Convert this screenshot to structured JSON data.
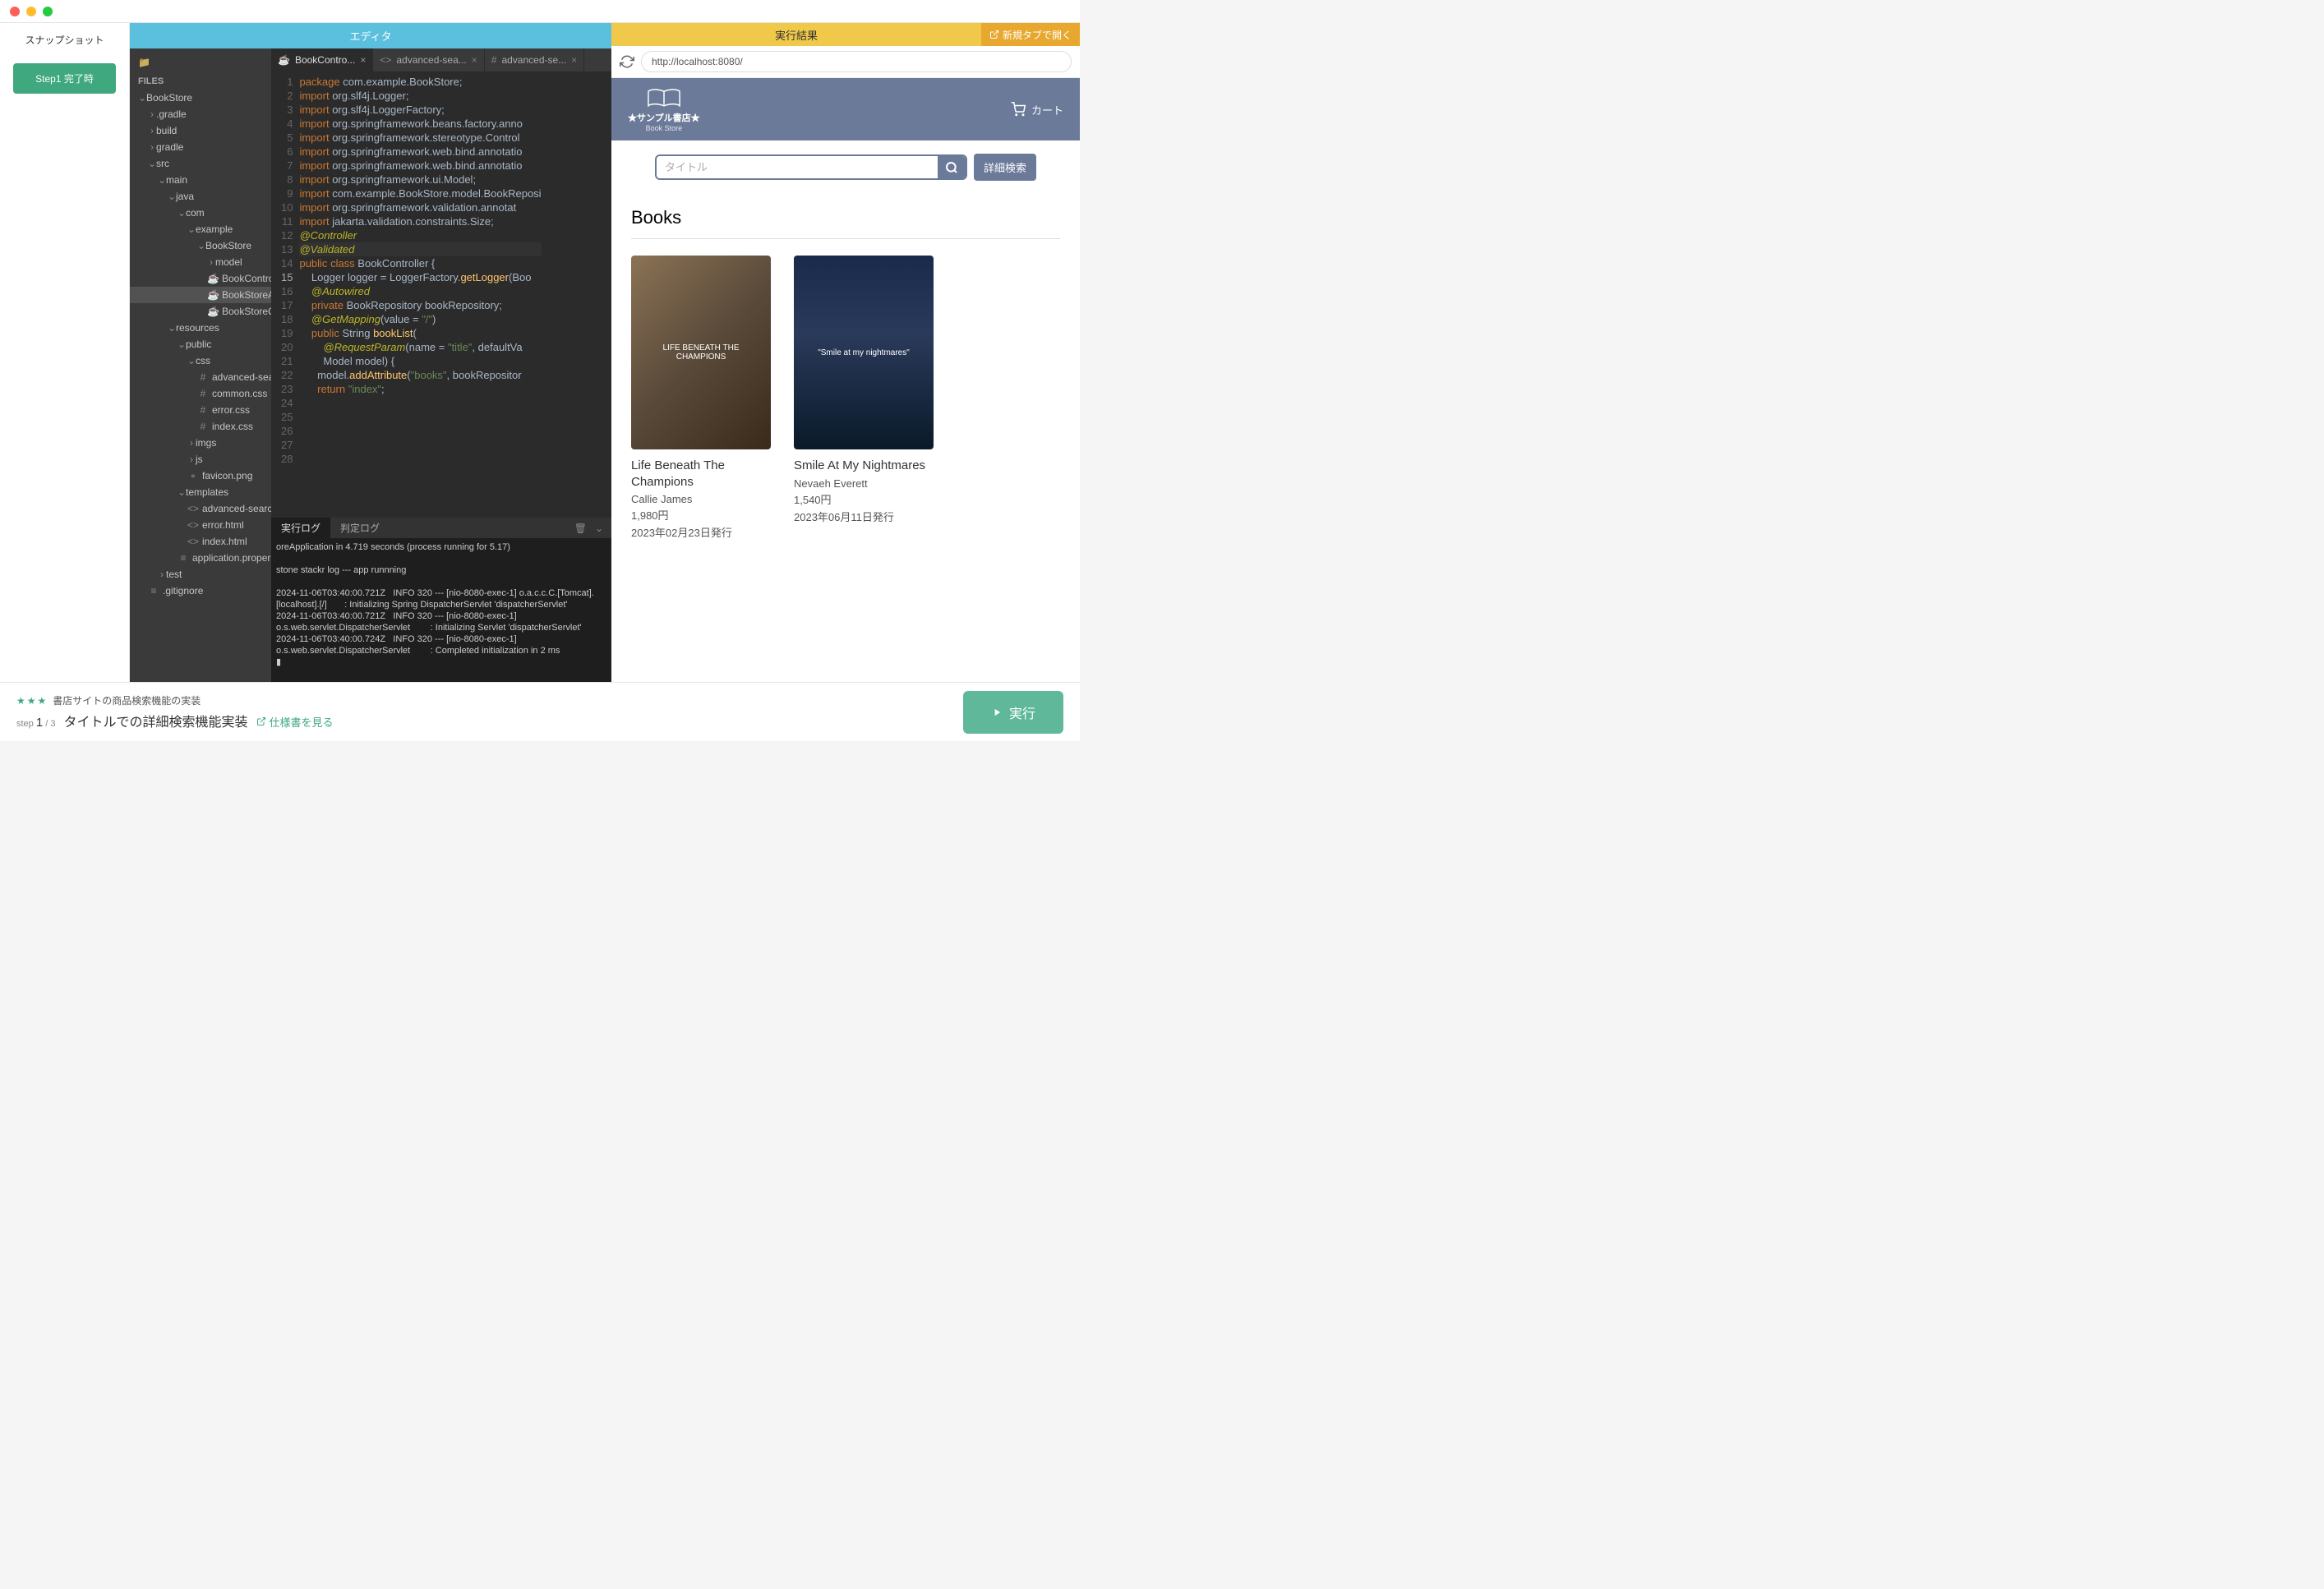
{
  "snapshot": {
    "title": "スナップショット",
    "step_btn": "Step1 完了時"
  },
  "editor": {
    "title": "エディタ"
  },
  "filetree": {
    "files_label": "FILES",
    "items": [
      {
        "label": "BookStore",
        "indent": 10,
        "expanded": true
      },
      {
        "label": ".gradle",
        "indent": 22,
        "expanded": false
      },
      {
        "label": "build",
        "indent": 22,
        "expanded": false
      },
      {
        "label": "gradle",
        "indent": 22,
        "expanded": false
      },
      {
        "label": "src",
        "indent": 22,
        "expanded": true
      },
      {
        "label": "main",
        "indent": 34,
        "expanded": true
      },
      {
        "label": "java",
        "indent": 46,
        "expanded": true
      },
      {
        "label": "com",
        "indent": 58,
        "expanded": true
      },
      {
        "label": "example",
        "indent": 70,
        "expanded": true
      },
      {
        "label": "BookStore",
        "indent": 82,
        "expanded": true
      },
      {
        "label": "model",
        "indent": 94,
        "expanded": false
      },
      {
        "label": "BookControll",
        "indent": 94,
        "file": "java"
      },
      {
        "label": "BookStoreAp",
        "indent": 94,
        "file": "java",
        "selected": true
      },
      {
        "label": "BookStoreCo",
        "indent": 94,
        "file": "java"
      },
      {
        "label": "resources",
        "indent": 46,
        "expanded": true
      },
      {
        "label": "public",
        "indent": 58,
        "expanded": true
      },
      {
        "label": "css",
        "indent": 70,
        "expanded": true
      },
      {
        "label": "advanced-sear",
        "indent": 82,
        "file": "css"
      },
      {
        "label": "common.css",
        "indent": 82,
        "file": "css"
      },
      {
        "label": "error.css",
        "indent": 82,
        "file": "css"
      },
      {
        "label": "index.css",
        "indent": 82,
        "file": "css"
      },
      {
        "label": "imgs",
        "indent": 70,
        "expanded": false
      },
      {
        "label": "js",
        "indent": 70,
        "expanded": false
      },
      {
        "label": "favicon.png",
        "indent": 70,
        "file": "img"
      },
      {
        "label": "templates",
        "indent": 58,
        "expanded": true
      },
      {
        "label": "advanced-searc",
        "indent": 70,
        "file": "html"
      },
      {
        "label": "error.html",
        "indent": 70,
        "file": "html"
      },
      {
        "label": "index.html",
        "indent": 70,
        "file": "html"
      },
      {
        "label": "application.proper",
        "indent": 58,
        "file": "cfg"
      },
      {
        "label": "test",
        "indent": 34,
        "expanded": false
      },
      {
        "label": ".gitignore",
        "indent": 22,
        "file": "cfg"
      }
    ]
  },
  "tabs": [
    {
      "label": "BookContro...",
      "icon": "java",
      "active": true
    },
    {
      "label": "advanced-sea...",
      "icon": "html",
      "active": false
    },
    {
      "label": "advanced-se...",
      "icon": "css",
      "active": false
    }
  ],
  "code": {
    "lines": [
      "<span class='kw'>package</span> com.example.BookStore;",
      "",
      "<span class='kw'>import</span> org.slf4j.Logger;",
      "<span class='kw'>import</span> org.slf4j.LoggerFactory;",
      "<span class='kw'>import</span> org.springframework.beans.factory.anno",
      "<span class='kw'>import</span> org.springframework.stereotype.Control",
      "<span class='kw'>import</span> org.springframework.web.bind.annotatio",
      "<span class='kw'>import</span> org.springframework.web.bind.annotatio",
      "<span class='kw'>import</span> org.springframework.ui.Model;",
      "<span class='kw'>import</span> com.example.BookStore.model.BookReposi",
      "<span class='kw'>import</span> org.springframework.validation.annotat",
      "<span class='kw'>import</span> jakarta.validation.constraints.Size;",
      "",
      "<span class='ann'>@Controller</span>",
      "<span class='ann'>@Validated</span>",
      "<span class='kw'>public</span> <span class='kw'>class</span> BookController {",
      "",
      "    Logger logger = LoggerFactory.<span class='fn'>getLogger</span>(Boo",
      "",
      "    <span class='ann'>@Autowired</span>",
      "    <span class='kw'>private</span> BookRepository bookRepository;",
      "",
      "    <span class='ann'>@GetMapping</span>(value = <span class='str'>\"/\"</span>)",
      "    <span class='kw'>public</span> String <span class='fn'>bookList</span>(",
      "        <span class='ann'>@RequestParam</span>(name = <span class='str'>\"title\"</span>, defaultVa",
      "        Model model) {",
      "      model.<span class='fn'>addAttribute</span>(<span class='str'>\"books\"</span>, bookRepositor",
      "      <span class='kw'>return</span> <span class='str'>\"index\"</span>;"
    ],
    "current_line": 15
  },
  "console": {
    "tab_run": "実行ログ",
    "tab_judge": "判定ログ",
    "body": "oreApplication in 4.719 seconds (process running for 5.17)\n\nstone stackr log --- app runnning\n\n2024-11-06T03:40:00.721Z   INFO 320 --- [nio-8080-exec-1] o.a.c.c.C.[Tomcat].[localhost].[/]       : Initializing Spring DispatcherServlet 'dispatcherServlet'\n2024-11-06T03:40:00.721Z   INFO 320 --- [nio-8080-exec-1] o.s.web.servlet.DispatcherServlet        : Initializing Servlet 'dispatcherServlet'\n2024-11-06T03:40:00.724Z   INFO 320 --- [nio-8080-exec-1] o.s.web.servlet.DispatcherServlet        : Completed initialization in 2 ms\n▮"
  },
  "result": {
    "title": "実行結果",
    "new_tab": "新規タブで開く",
    "url": "http://localhost:8080/",
    "site_name": "★サンプル書店★",
    "site_sub": "Book Store",
    "cart": "カート",
    "search_placeholder": "タイトル",
    "adv_search": "詳細検索",
    "books_heading": "Books",
    "books": [
      {
        "title": "Life Beneath The Champions",
        "author": "Callie James",
        "price": "1,980円",
        "date": "2023年02月23日発行",
        "cover_text": "LIFE BENEATH THE CHAMPIONS"
      },
      {
        "title": "Smile At My Nightmares",
        "author": "Nevaeh Everett",
        "price": "1,540円",
        "date": "2023年06月11日発行",
        "cover_text": "\"Smile at my nightmares\""
      }
    ]
  },
  "footer": {
    "difficulty": "★★★",
    "project": "書店サイトの商品検索機能の実装",
    "step_label": "step",
    "step_cur": "1",
    "step_total": "/ 3",
    "task": "タイトルでの詳細検索機能実装",
    "spec_link": "仕様書を見る",
    "run": "実行"
  }
}
